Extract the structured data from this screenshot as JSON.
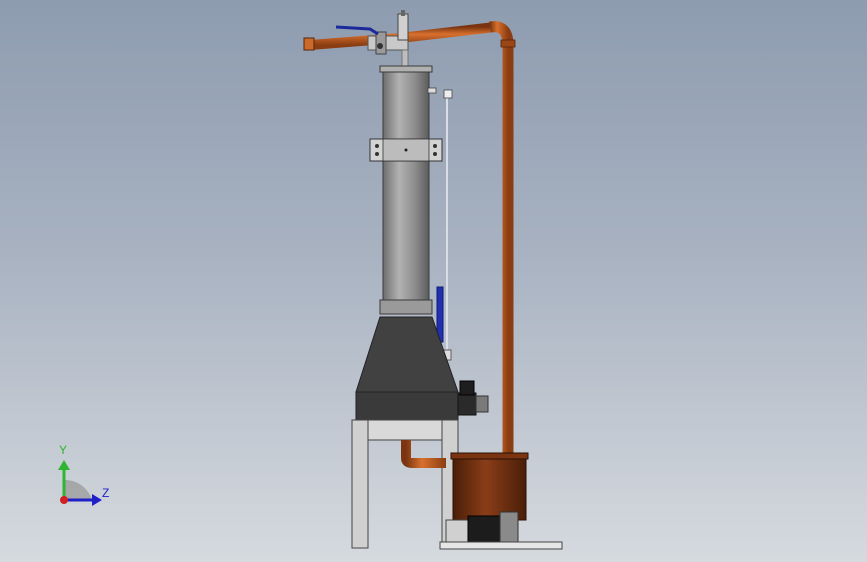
{
  "viewport": {
    "background_top": "#8e9cb0",
    "background_bottom": "#d6dadf"
  },
  "triad": {
    "y_label": "Y",
    "z_label": "Z",
    "y_color": "#2fb52f",
    "z_color": "#2020c8",
    "x_color": "#d02020"
  },
  "model": {
    "pipe_color": "#b8541a",
    "column_color": "#8a8a8a",
    "hopper_color": "#3f3f3f",
    "tank_color": "#6a2e10",
    "valve_handle_color": "#1a2a9a",
    "level_gauge_color": "#2030b0",
    "frame_color": "#c8c8c8"
  }
}
